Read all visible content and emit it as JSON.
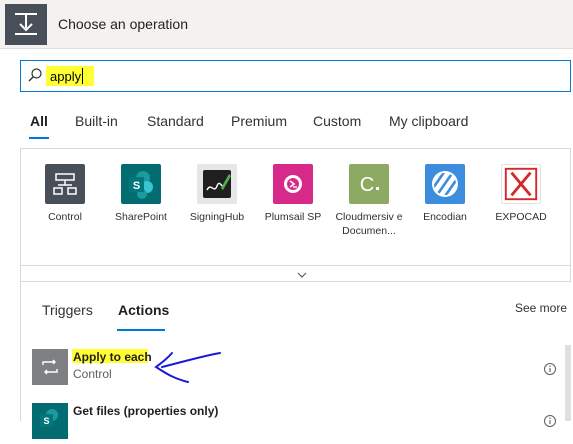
{
  "header": {
    "title": "Choose an operation",
    "icon": "download-icon"
  },
  "search": {
    "value": "apply",
    "highlight_color": "#ffff33",
    "icon": "search-icon"
  },
  "categories": [
    "All",
    "Built-in",
    "Standard",
    "Premium",
    "Custom",
    "My clipboard"
  ],
  "selected_category": "All",
  "connectors": [
    {
      "label": "Control",
      "color": "#484f58",
      "icon": "control-icon"
    },
    {
      "label": "SharePoint",
      "color": "#036c70",
      "icon": "sharepoint-icon"
    },
    {
      "label": "SigningHub",
      "color": "#e6e6e6",
      "icon": "signinghub-icon"
    },
    {
      "label": "Plumsail SP",
      "color": "#d7298a",
      "icon": "plumsail-icon"
    },
    {
      "label": "Cloudmersiv e Documen...",
      "color": "#8eaa62",
      "icon": "cloudmersive-icon"
    },
    {
      "label": "Encodian",
      "color": "#3c8dde",
      "icon": "encodian-icon"
    },
    {
      "label": "EXPOCAD",
      "color": "#ffffff",
      "icon": "expocad-icon"
    }
  ],
  "results": {
    "tabs": [
      "Triggers",
      "Actions"
    ],
    "selected_tab": "Actions",
    "see_more": "See more",
    "actions": [
      {
        "title": "Apply to each",
        "subtitle": "Control",
        "icon": "loop-icon",
        "icon_color": "#7f8084"
      },
      {
        "title": "Get files (properties only)",
        "subtitle": "",
        "icon": "sharepoint-icon",
        "icon_color": "#036c70"
      }
    ]
  },
  "annotation": {
    "color": "#1a1ad6",
    "shape": "arrow"
  }
}
